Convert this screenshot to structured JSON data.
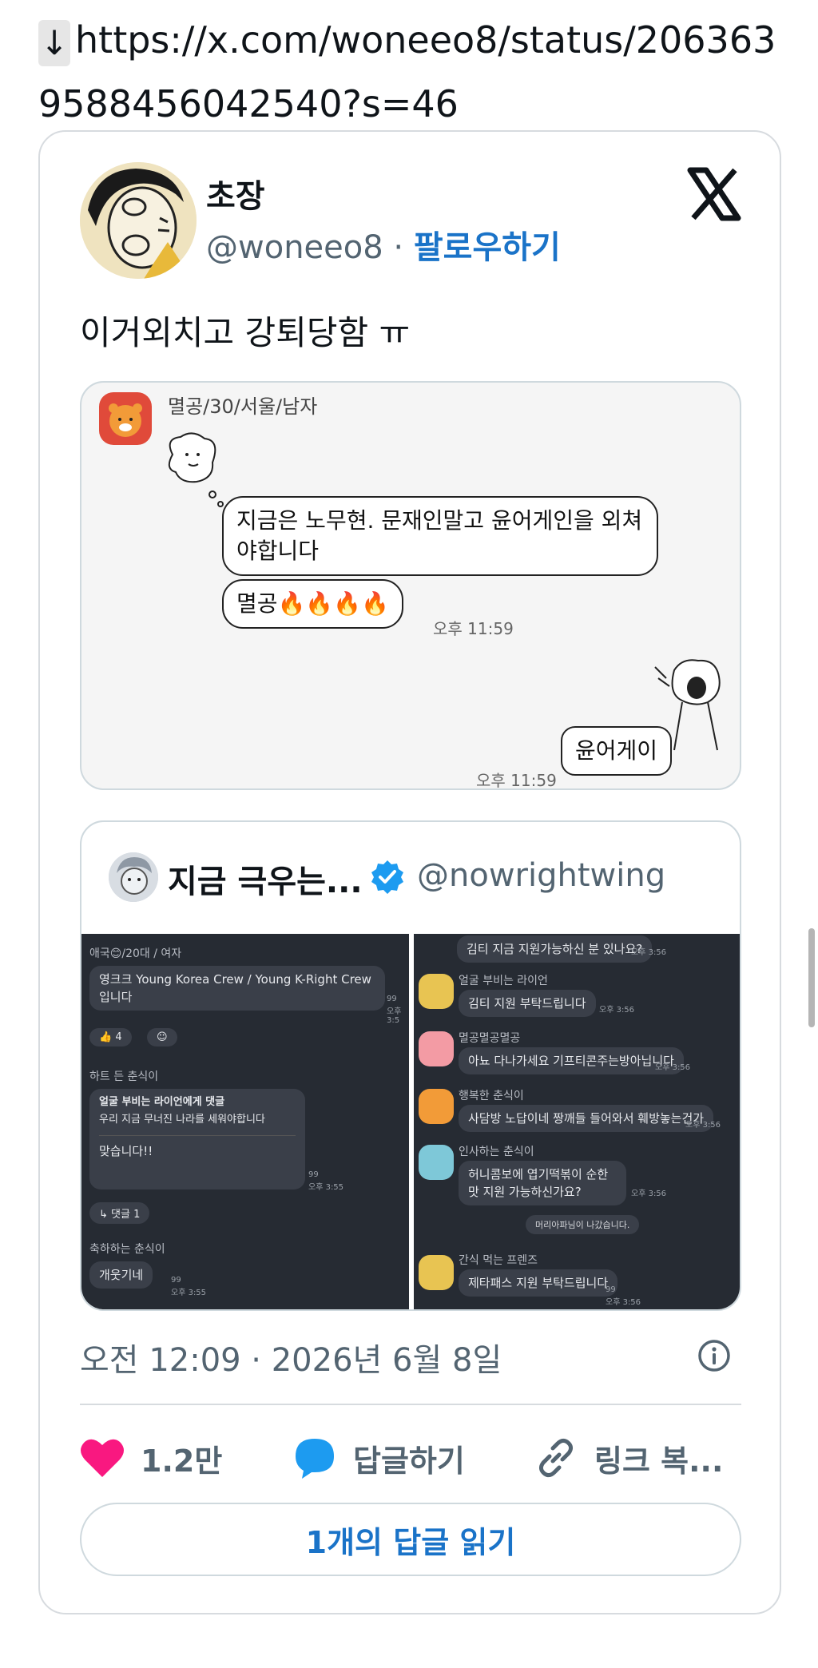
{
  "url": {
    "arrow": "↓",
    "text": "https://x.com/woneeo8/status/2063639588456042540?s=46"
  },
  "tweet": {
    "author_name": "초장",
    "author_handle": "@woneeo8",
    "separator": " · ",
    "follow_label": "팔로우하기",
    "text": "이거외치고 강퇴당함 ㅠ",
    "timestamp": "오전 12:09 · 2026년 6월 8일",
    "likes": "1.2만",
    "reply_label": "답글하기",
    "copy_link_label": "링크 복...",
    "read_replies_label": "1개의 답글 읽기"
  },
  "embedded_chat": {
    "sender": "멸공/30/서울/남자",
    "message1": "지금은 노무현. 문재인말고 윤어게인을 외쳐야합니다",
    "message2": "멸공🔥🔥🔥🔥",
    "time1": "오후 11:59",
    "reply": "윤어게이",
    "time2": "오후 11:59"
  },
  "quote": {
    "name": "지금 극우는...",
    "handle": "@nowrightwing"
  },
  "quote_left": {
    "sender1": "애국😊/20대 / 여자",
    "msg1": "영크크 Young Korea Crew / Young K-Right Crew 입니다",
    "read1": "99",
    "time1": "오후 3:5",
    "reaction_count": "4",
    "sender2": "하트 든 춘식이",
    "reply_header": "얼굴 부비는 라이언에게 댓글",
    "reply_quote": "우리 지금 무너진 나라를 세워야합니다",
    "reply_body": "맞습니다!!",
    "read2": "99",
    "time2": "오후 3:55",
    "reply_count_label": "↳ 댓글 1",
    "sender3": "축하하는 춘식이",
    "msg3": "개웃기네",
    "read3": "99",
    "time3": "오후 3:55"
  },
  "quote_right": {
    "msg0": "김티 지금 지원가능하신 분 있나요?",
    "sender1": "얼굴 부비는 라이언",
    "msg1": "김티 지원 부탁드립니다",
    "sender2": "멸공멸공멸공",
    "msg2": "아뇨 다나가세요 기프티콘주는방아닙니다",
    "sender3": "행복한 춘식이",
    "msg3": "사담방 노답이네 짱깨들 들어와서 훼방놓는건가",
    "sender4": "인사하는 춘식이",
    "msg4": "허니콤보에 엽기떡볶이 순한맛 지원 가능하신가요?",
    "notice": "머리아파님이 나갔습니다.",
    "sender5": "간식 먹는 프렌즈",
    "msg5": "제타패스 지원 부탁드립니다",
    "read": "99",
    "time": "오후 3:56"
  },
  "colors": {
    "link_blue": "#1a73c8",
    "like_pink": "#f91880",
    "reply_blue": "#1d9bf0",
    "dark_chat_bg": "#262b33"
  }
}
